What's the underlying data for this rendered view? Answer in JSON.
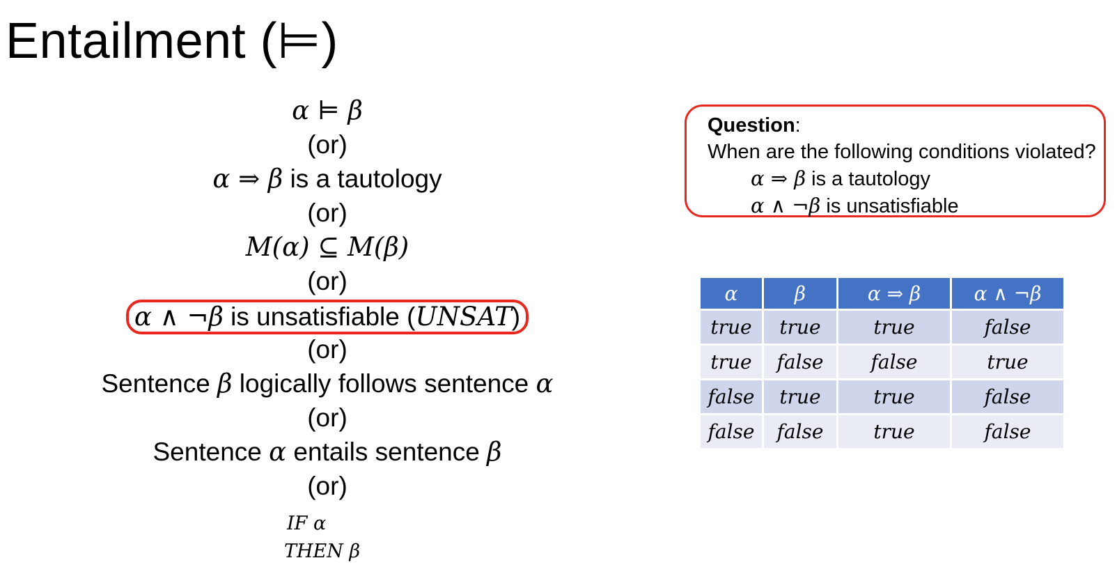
{
  "title": "Entailment (⊨)",
  "equivalences": {
    "line1": "α ⊨ β",
    "or": "(or)",
    "line2_math": "α ⇒ β",
    "line2_text": " is a tautology",
    "line3": "M(α) ⊆ M(β)",
    "line4_math": "α ∧ ¬β",
    "line4_text": " is unsatisfiable (",
    "line4_unsat": "UNSAT",
    "line4_close": ")",
    "line5_a": "Sentence ",
    "line5_beta": "β",
    "line5_b": " logically follows sentence ",
    "line5_alpha": "α",
    "line6_a": "Sentence ",
    "line6_alpha": "α",
    "line6_b": " entails sentence ",
    "line6_beta": "β",
    "if_line": "IF α",
    "then_line": "THEN β"
  },
  "question": {
    "heading": "Question",
    "colon": ":",
    "prompt": "When are the following conditions violated?",
    "cond1_math": "α ⇒ β",
    "cond1_text": " is a tautology",
    "cond2_math": "α ∧ ¬β",
    "cond2_text": " is unsatisfiable"
  },
  "truth_table": {
    "headers": [
      "α",
      "β",
      "α ⇒ β",
      "α ∧ ¬β"
    ],
    "rows": [
      [
        "true",
        "true",
        "true",
        "false"
      ],
      [
        "true",
        "false",
        "false",
        "true"
      ],
      [
        "false",
        "true",
        "true",
        "false"
      ],
      [
        "false",
        "false",
        "true",
        "false"
      ]
    ]
  },
  "colors": {
    "highlight_border": "#e8281e",
    "table_header": "#4472c4",
    "table_row_dark": "#cfd5ea",
    "table_row_light": "#e9ebf5"
  }
}
